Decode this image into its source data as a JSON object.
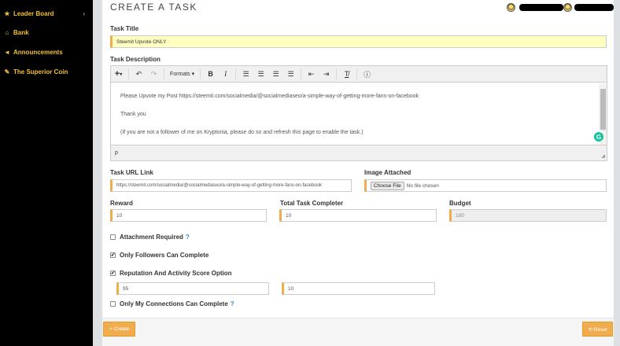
{
  "sidebar": {
    "items": [
      {
        "icon": "star-icon",
        "glyph": "★",
        "label": "Leader Board",
        "chevron": "‹"
      },
      {
        "icon": "bank-icon",
        "glyph": "🏛",
        "label": "Bank"
      },
      {
        "icon": "bullhorn-icon",
        "glyph": "📢",
        "label": "Announcements"
      },
      {
        "icon": "edit-icon",
        "glyph": "✎",
        "label": "The Superior Coin"
      }
    ]
  },
  "header": {
    "title": "CREATE A TASK"
  },
  "form": {
    "task_title_label": "Task Title",
    "task_title_value": "Steemit Upvote ONLY",
    "task_description_label": "Task Description",
    "editor": {
      "formats_label": "Formats",
      "lines": [
        "Please Upvote my Post https://steemit.com/socialmedia/@socialmediaseo/a-simple-way-of-getting-more-fans-on-facebook",
        "Thank you",
        "(If you are not a follower of me on Kryptonia, please do so and refresh this page to enable the task.)"
      ],
      "status_path": "p"
    },
    "task_url_label": "Task URL Link",
    "task_url_value": "https://steemit.com/socialmedia/@socialmediaseo/a-simple-way-of-getting-more-fans-on-facebook",
    "image_label": "Image Attached",
    "choose_file_label": "Choose File",
    "no_file_text": "No file chosen",
    "reward_label": "Reward",
    "reward_value": "10",
    "total_label": "Total Task Completer",
    "total_value": "10",
    "budget_label": "Budget",
    "budget_value": "100",
    "attachment_required_label": "Attachment Required",
    "only_followers_label": "Only Followers Can Complete",
    "reputation_label": "Reputation And Activity Score Option",
    "reputation_value": "95",
    "activity_value": "10",
    "only_connections_label": "Only My Connections Can Complete",
    "help_mark": "?",
    "check_mark": "✔"
  },
  "footer": {
    "create_label": "+ Create",
    "reset_label": "⟲ Reset"
  },
  "colors": {
    "accent": "#f0ad4e",
    "sidebar_text": "#f2c037",
    "sidebar_bg": "#000000"
  }
}
